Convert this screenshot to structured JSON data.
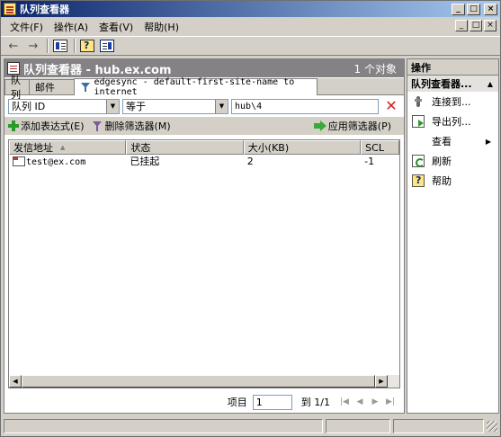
{
  "window": {
    "title": "队列查看器",
    "controls": {
      "minimize": "_",
      "maximize": "□",
      "close": "×"
    }
  },
  "menubar": {
    "items": [
      "文件(F)",
      "操作(A)",
      "查看(V)",
      "帮助(H)"
    ]
  },
  "main": {
    "header_title": "队列查看器 - hub.ex.com",
    "object_count": "1 个对象",
    "tabs": [
      {
        "label": "队列"
      },
      {
        "label": "邮件"
      },
      {
        "label": "edgesync - default-first-site-name to internet"
      }
    ],
    "filter": {
      "field": "队列 ID",
      "operator": "等于",
      "value": "hub\\4"
    },
    "actions": {
      "add_expression": "添加表达式(E)",
      "remove_filter": "删除筛选器(M)",
      "apply_filter": "应用筛选器(P)"
    },
    "columns": [
      "发信地址",
      "状态",
      "大小(KB)",
      "SCL"
    ],
    "rows": [
      {
        "from": "test@ex.com",
        "status": "已挂起",
        "size": "2",
        "scl": "-1"
      }
    ],
    "pager": {
      "item_label": "项目",
      "page_value": "1",
      "of_label": "到 1/1"
    }
  },
  "action_pane": {
    "title": "操作",
    "section": "队列查看器...",
    "items": [
      {
        "label": "连接到...",
        "icon": "connect-icon"
      },
      {
        "label": "导出列...",
        "icon": "export-list-icon"
      },
      {
        "label": "查看",
        "icon": "none",
        "submenu": true
      },
      {
        "label": "刷新",
        "icon": "refresh-icon"
      },
      {
        "label": "帮助",
        "icon": "help-icon"
      }
    ]
  },
  "colors": {
    "title_bar_start": "#0a246a",
    "title_bar_end": "#a6caf0",
    "header_bg": "#848284",
    "window_bg": "#d4d0c8",
    "remove_x": "#d32020"
  }
}
